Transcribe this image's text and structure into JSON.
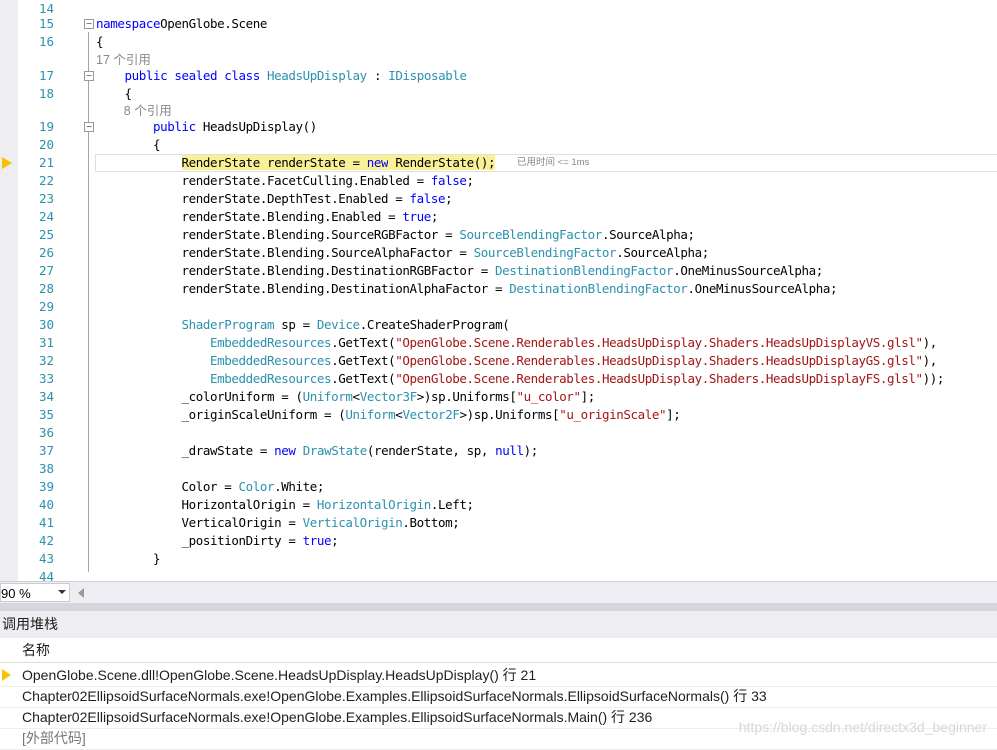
{
  "editor": {
    "lines": [
      {
        "n": "14",
        "segs": []
      },
      {
        "n": "15",
        "segs": [
          [
            "kw",
            "namespace"
          ],
          [
            "",
            "OpenGlobe.Scene"
          ]
        ]
      },
      {
        "n": "16",
        "segs": [
          [
            "",
            "{"
          ]
        ]
      },
      {
        "lens": "17 个引用"
      },
      {
        "n": "17",
        "segs": [
          [
            "",
            "    "
          ],
          [
            "kw",
            "public sealed class"
          ],
          [
            "",
            " "
          ],
          [
            "ty",
            "HeadsUpDisplay"
          ],
          [
            "",
            " : "
          ],
          [
            "ty",
            "IDisposable"
          ]
        ]
      },
      {
        "n": "18",
        "segs": [
          [
            "",
            "    {"
          ]
        ]
      },
      {
        "lens": "        8 个引用"
      },
      {
        "n": "19",
        "segs": [
          [
            "",
            "        "
          ],
          [
            "kw",
            "public"
          ],
          [
            "",
            " HeadsUpDisplay()"
          ]
        ]
      },
      {
        "n": "20",
        "segs": [
          [
            "",
            "        {"
          ]
        ]
      },
      {
        "n": "21",
        "segs": [
          [
            "",
            "            "
          ],
          [
            "hl",
            "RenderState renderState = "
          ],
          [
            "hlkw",
            "new"
          ],
          [
            "hl",
            " RenderState();"
          ]
        ],
        "perf": "已用时间 <= 1ms"
      },
      {
        "n": "22",
        "segs": [
          [
            "",
            "            renderState.FacetCulling.Enabled = "
          ],
          [
            "kw",
            "false"
          ],
          [
            "",
            ";"
          ]
        ]
      },
      {
        "n": "23",
        "segs": [
          [
            "",
            "            renderState.DepthTest.Enabled = "
          ],
          [
            "kw",
            "false"
          ],
          [
            "",
            ";"
          ]
        ]
      },
      {
        "n": "24",
        "segs": [
          [
            "",
            "            renderState.Blending.Enabled = "
          ],
          [
            "kw",
            "true"
          ],
          [
            "",
            ";"
          ]
        ]
      },
      {
        "n": "25",
        "segs": [
          [
            "",
            "            renderState.Blending.SourceRGBFactor = "
          ],
          [
            "ty",
            "SourceBlendingFactor"
          ],
          [
            "",
            ".SourceAlpha;"
          ]
        ]
      },
      {
        "n": "26",
        "segs": [
          [
            "",
            "            renderState.Blending.SourceAlphaFactor = "
          ],
          [
            "ty",
            "SourceBlendingFactor"
          ],
          [
            "",
            ".SourceAlpha;"
          ]
        ]
      },
      {
        "n": "27",
        "segs": [
          [
            "",
            "            renderState.Blending.DestinationRGBFactor = "
          ],
          [
            "ty",
            "DestinationBlendingFactor"
          ],
          [
            "",
            ".OneMinusSourceAlpha;"
          ]
        ]
      },
      {
        "n": "28",
        "segs": [
          [
            "",
            "            renderState.Blending.DestinationAlphaFactor = "
          ],
          [
            "ty",
            "DestinationBlendingFactor"
          ],
          [
            "",
            ".OneMinusSourceAlpha;"
          ]
        ]
      },
      {
        "n": "29",
        "segs": []
      },
      {
        "n": "30",
        "segs": [
          [
            "",
            "            "
          ],
          [
            "ty",
            "ShaderProgram"
          ],
          [
            "",
            " sp = "
          ],
          [
            "ty",
            "Device"
          ],
          [
            "",
            ".CreateShaderProgram("
          ]
        ]
      },
      {
        "n": "31",
        "segs": [
          [
            "",
            "                "
          ],
          [
            "ty",
            "EmbeddedResources"
          ],
          [
            "",
            ".GetText("
          ],
          [
            "st",
            "\"OpenGlobe.Scene.Renderables.HeadsUpDisplay.Shaders.HeadsUpDisplayVS.glsl\""
          ],
          [
            "",
            "),"
          ]
        ]
      },
      {
        "n": "32",
        "segs": [
          [
            "",
            "                "
          ],
          [
            "ty",
            "EmbeddedResources"
          ],
          [
            "",
            ".GetText("
          ],
          [
            "st",
            "\"OpenGlobe.Scene.Renderables.HeadsUpDisplay.Shaders.HeadsUpDisplayGS.glsl\""
          ],
          [
            "",
            "),"
          ]
        ]
      },
      {
        "n": "33",
        "segs": [
          [
            "",
            "                "
          ],
          [
            "ty",
            "EmbeddedResources"
          ],
          [
            "",
            ".GetText("
          ],
          [
            "st",
            "\"OpenGlobe.Scene.Renderables.HeadsUpDisplay.Shaders.HeadsUpDisplayFS.glsl\""
          ],
          [
            "",
            "));"
          ]
        ]
      },
      {
        "n": "34",
        "segs": [
          [
            "",
            "            _colorUniform = ("
          ],
          [
            "ty",
            "Uniform"
          ],
          [
            "",
            "<"
          ],
          [
            "ty",
            "Vector3F"
          ],
          [
            "",
            ">)sp.Uniforms["
          ],
          [
            "st",
            "\"u_color\""
          ],
          [
            "",
            "];"
          ]
        ]
      },
      {
        "n": "35",
        "segs": [
          [
            "",
            "            _originScaleUniform = ("
          ],
          [
            "ty",
            "Uniform"
          ],
          [
            "",
            "<"
          ],
          [
            "ty",
            "Vector2F"
          ],
          [
            "",
            ">)sp.Uniforms["
          ],
          [
            "st",
            "\"u_originScale\""
          ],
          [
            "",
            "];"
          ]
        ]
      },
      {
        "n": "36",
        "segs": []
      },
      {
        "n": "37",
        "segs": [
          [
            "",
            "            _drawState = "
          ],
          [
            "kw",
            "new"
          ],
          [
            "",
            " "
          ],
          [
            "ty",
            "DrawState"
          ],
          [
            "",
            "(renderState, sp, "
          ],
          [
            "kw",
            "null"
          ],
          [
            "",
            ");"
          ]
        ]
      },
      {
        "n": "38",
        "segs": []
      },
      {
        "n": "39",
        "segs": [
          [
            "",
            "            Color = "
          ],
          [
            "ty",
            "Color"
          ],
          [
            "",
            ".White;"
          ]
        ]
      },
      {
        "n": "40",
        "segs": [
          [
            "",
            "            HorizontalOrigin = "
          ],
          [
            "ty",
            "HorizontalOrigin"
          ],
          [
            "",
            ".Left;"
          ]
        ]
      },
      {
        "n": "41",
        "segs": [
          [
            "",
            "            VerticalOrigin = "
          ],
          [
            "ty",
            "VerticalOrigin"
          ],
          [
            "",
            ".Bottom;"
          ]
        ]
      },
      {
        "n": "42",
        "segs": [
          [
            "",
            "            _positionDirty = "
          ],
          [
            "kw",
            "true"
          ],
          [
            "",
            ";"
          ]
        ]
      },
      {
        "n": "43",
        "segs": [
          [
            "",
            "        }"
          ]
        ]
      },
      {
        "n": "44",
        "segs": []
      }
    ]
  },
  "zoom": {
    "value": "90 %"
  },
  "callstack": {
    "title": "调用堆栈",
    "column_name": "名称",
    "rows": [
      {
        "text": "OpenGlobe.Scene.dll!OpenGlobe.Scene.HeadsUpDisplay.HeadsUpDisplay() 行 21",
        "current": true
      },
      {
        "text": "Chapter02EllipsoidSurfaceNormals.exe!OpenGlobe.Examples.EllipsoidSurfaceNormals.EllipsoidSurfaceNormals() 行 33",
        "current": false
      },
      {
        "text": "Chapter02EllipsoidSurfaceNormals.exe!OpenGlobe.Examples.EllipsoidSurfaceNormals.Main() 行 236",
        "current": false
      },
      {
        "text": "[外部代码]",
        "current": false,
        "external": true
      }
    ]
  },
  "watermark": "https://blog.csdn.net/directx3d_beginner",
  "colors": {
    "keyword": "#0000ff",
    "type": "#2b91af",
    "string": "#a31515",
    "linenumber": "#2b91af",
    "highlight": "#faf096",
    "arrow": "#f5c400"
  },
  "icons": {
    "current_line": "execution-arrow-icon",
    "fold": "fold-collapse-icon"
  }
}
